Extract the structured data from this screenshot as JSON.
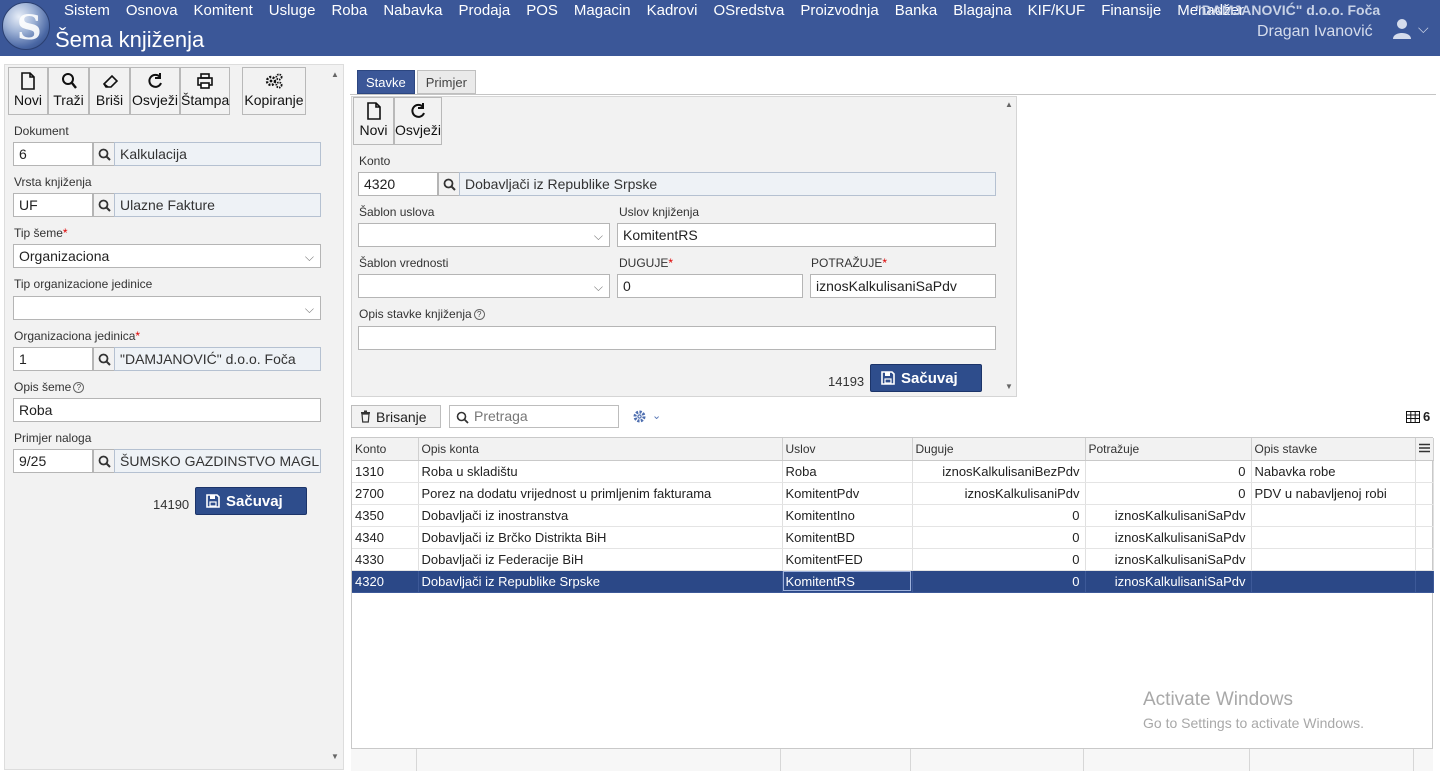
{
  "header": {
    "menu": [
      "Sistem",
      "Osnova",
      "Komitent",
      "Usluge",
      "Roba",
      "Nabavka",
      "Prodaja",
      "POS",
      "Magacin",
      "Kadrovi",
      "OSredstva",
      "Proizvodnja",
      "Banka",
      "Blagajna",
      "KIF/KUF",
      "Finansije",
      "Menadžer"
    ],
    "page_title": "Šema knjiženja",
    "company": "\"DAMJANOVIĆ\" d.o.o. Foča",
    "user": "Dragan Ivanović"
  },
  "left": {
    "toolbar": {
      "novi": "Novi",
      "trazi": "Traži",
      "brisi": "Briši",
      "osvjezi": "Osvježi",
      "stampa": "Štampa",
      "kopiranje": "Kopiranje"
    },
    "dokument": {
      "label": "Dokument",
      "value": "6",
      "name": "Kalkulacija"
    },
    "vrsta": {
      "label": "Vrsta knjiženja",
      "value": "UF",
      "name": "Ulazne Fakture"
    },
    "tip_seme": {
      "label": "Tip šeme",
      "req": "*",
      "value": "Organizaciona"
    },
    "tip_org": {
      "label": "Tip organizacione jedinice",
      "value": ""
    },
    "org_jed": {
      "label": "Organizaciona jedinica",
      "req": "*",
      "value": "1",
      "name": "\"DAMJANOVIĆ\" d.o.o. Foča"
    },
    "opis": {
      "label": "Opis šeme",
      "value": "Roba"
    },
    "primjer": {
      "label": "Primjer naloga",
      "value": "9/25",
      "name": "ŠUMSKO GAZDINSTVO MAGL"
    },
    "record_id": "14190",
    "save": "Sačuvaj"
  },
  "tabs": [
    "Stavke",
    "Primjer"
  ],
  "detail": {
    "toolbar": {
      "novi": "Novi",
      "osvjezi": "Osvježi"
    },
    "konto": {
      "label": "Konto",
      "value": "4320",
      "name": "Dobavljači iz Republike Srpske"
    },
    "sablon_uslova": {
      "label": "Šablon uslova",
      "value": ""
    },
    "uslov": {
      "label": "Uslov knjiženja",
      "value": "KomitentRS"
    },
    "sablon_vrednosti": {
      "label": "Šablon vrednosti",
      "value": ""
    },
    "duguje": {
      "label": "DUGUJE",
      "req": "*",
      "value": "0"
    },
    "potrazuje": {
      "label": "POTRAŽUJE",
      "req": "*",
      "value": "iznosKalkulisaniSaPdv"
    },
    "opis_stavke": {
      "label": "Opis stavke knjiženja",
      "value": ""
    },
    "record_id": "14193",
    "save": "Sačuvaj"
  },
  "grid_toolbar": {
    "brisanje": "Brisanje",
    "search_placeholder": "Pretraga",
    "count": "6"
  },
  "grid": {
    "columns": [
      "Konto",
      "Opis konta",
      "Uslov",
      "Duguje",
      "Potražuje",
      "Opis stavke"
    ],
    "rows": [
      [
        "1310",
        "Roba u skladištu",
        "Roba",
        "iznosKalkulisaniBezPdv",
        "0",
        "Nabavka robe"
      ],
      [
        "2700",
        "Porez na dodatu vrijednost u primljenim fakturama",
        "KomitentPdv",
        "iznosKalkulisaniPdv",
        "0",
        "PDV u nabavljenoj robi"
      ],
      [
        "4350",
        "Dobavljači iz inostranstva",
        "KomitentIno",
        "0",
        "iznosKalkulisaniSaPdv",
        ""
      ],
      [
        "4340",
        "Dobavljači iz Brčko Distrikta BiH",
        "KomitentBD",
        "0",
        "iznosKalkulisaniSaPdv",
        ""
      ],
      [
        "4330",
        "Dobavljači iz Federacije BiH",
        "KomitentFED",
        "0",
        "iznosKalkulisaniSaPdv",
        ""
      ],
      [
        "4320",
        "Dobavljači iz Republike Srpske",
        "KomitentRS",
        "0",
        "iznosKalkulisaniSaPdv",
        ""
      ]
    ]
  },
  "watermark": {
    "title": "Activate Windows",
    "subtitle": "Go to Settings to activate Windows."
  }
}
